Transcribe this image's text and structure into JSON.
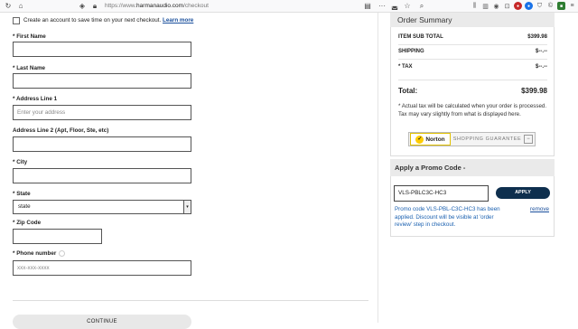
{
  "browser": {
    "url_prefix": "https://www.",
    "url_domain": "harmanaudio.com",
    "url_path": "/checkout"
  },
  "form": {
    "create_account_text": "Create an account to save time on your next checkout.",
    "create_account_link": "Learn more",
    "first_name_label": "* First Name",
    "first_name_value": "",
    "last_name_label": "* Last Name",
    "last_name_value": "",
    "address1_label": "* Address Line 1",
    "address1_placeholder": "Enter your address",
    "address2_label": "Address Line 2 (Apt, Floor, Ste, etc)",
    "address2_value": "",
    "city_label": "* City",
    "city_value": "",
    "state_label": "* State",
    "state_value": "state",
    "zip_label": "* Zip Code",
    "zip_value": "",
    "phone_label": "* Phone number",
    "phone_placeholder": "xxx-xxx-xxxx",
    "continue_label": "CONTINUE"
  },
  "summary": {
    "title": "Order Summary",
    "rows": [
      {
        "label": "ITEM SUB TOTAL",
        "value": "$399.98"
      },
      {
        "label": "SHIPPING",
        "value": "$--.--"
      },
      {
        "label": "* TAX",
        "value": "$--.--"
      }
    ],
    "total_label": "Total:",
    "total_value": "$399.98",
    "tax_note": "* Actual tax will be calculated when your order is processed. Tax may vary slightly from what is displayed here.",
    "norton_brand": "Norton",
    "norton_text": "SHOPPING GUARANTEE"
  },
  "promo": {
    "title": "Apply a Promo Code -",
    "code_value": "VLS-PBLC3C-HC3",
    "apply_label": "APPLY",
    "message": "Promo code VLS-PBL-C3C-HC3 has been applied. Discount will be visible at 'order review' step in checkout.",
    "remove_label": "remove"
  }
}
